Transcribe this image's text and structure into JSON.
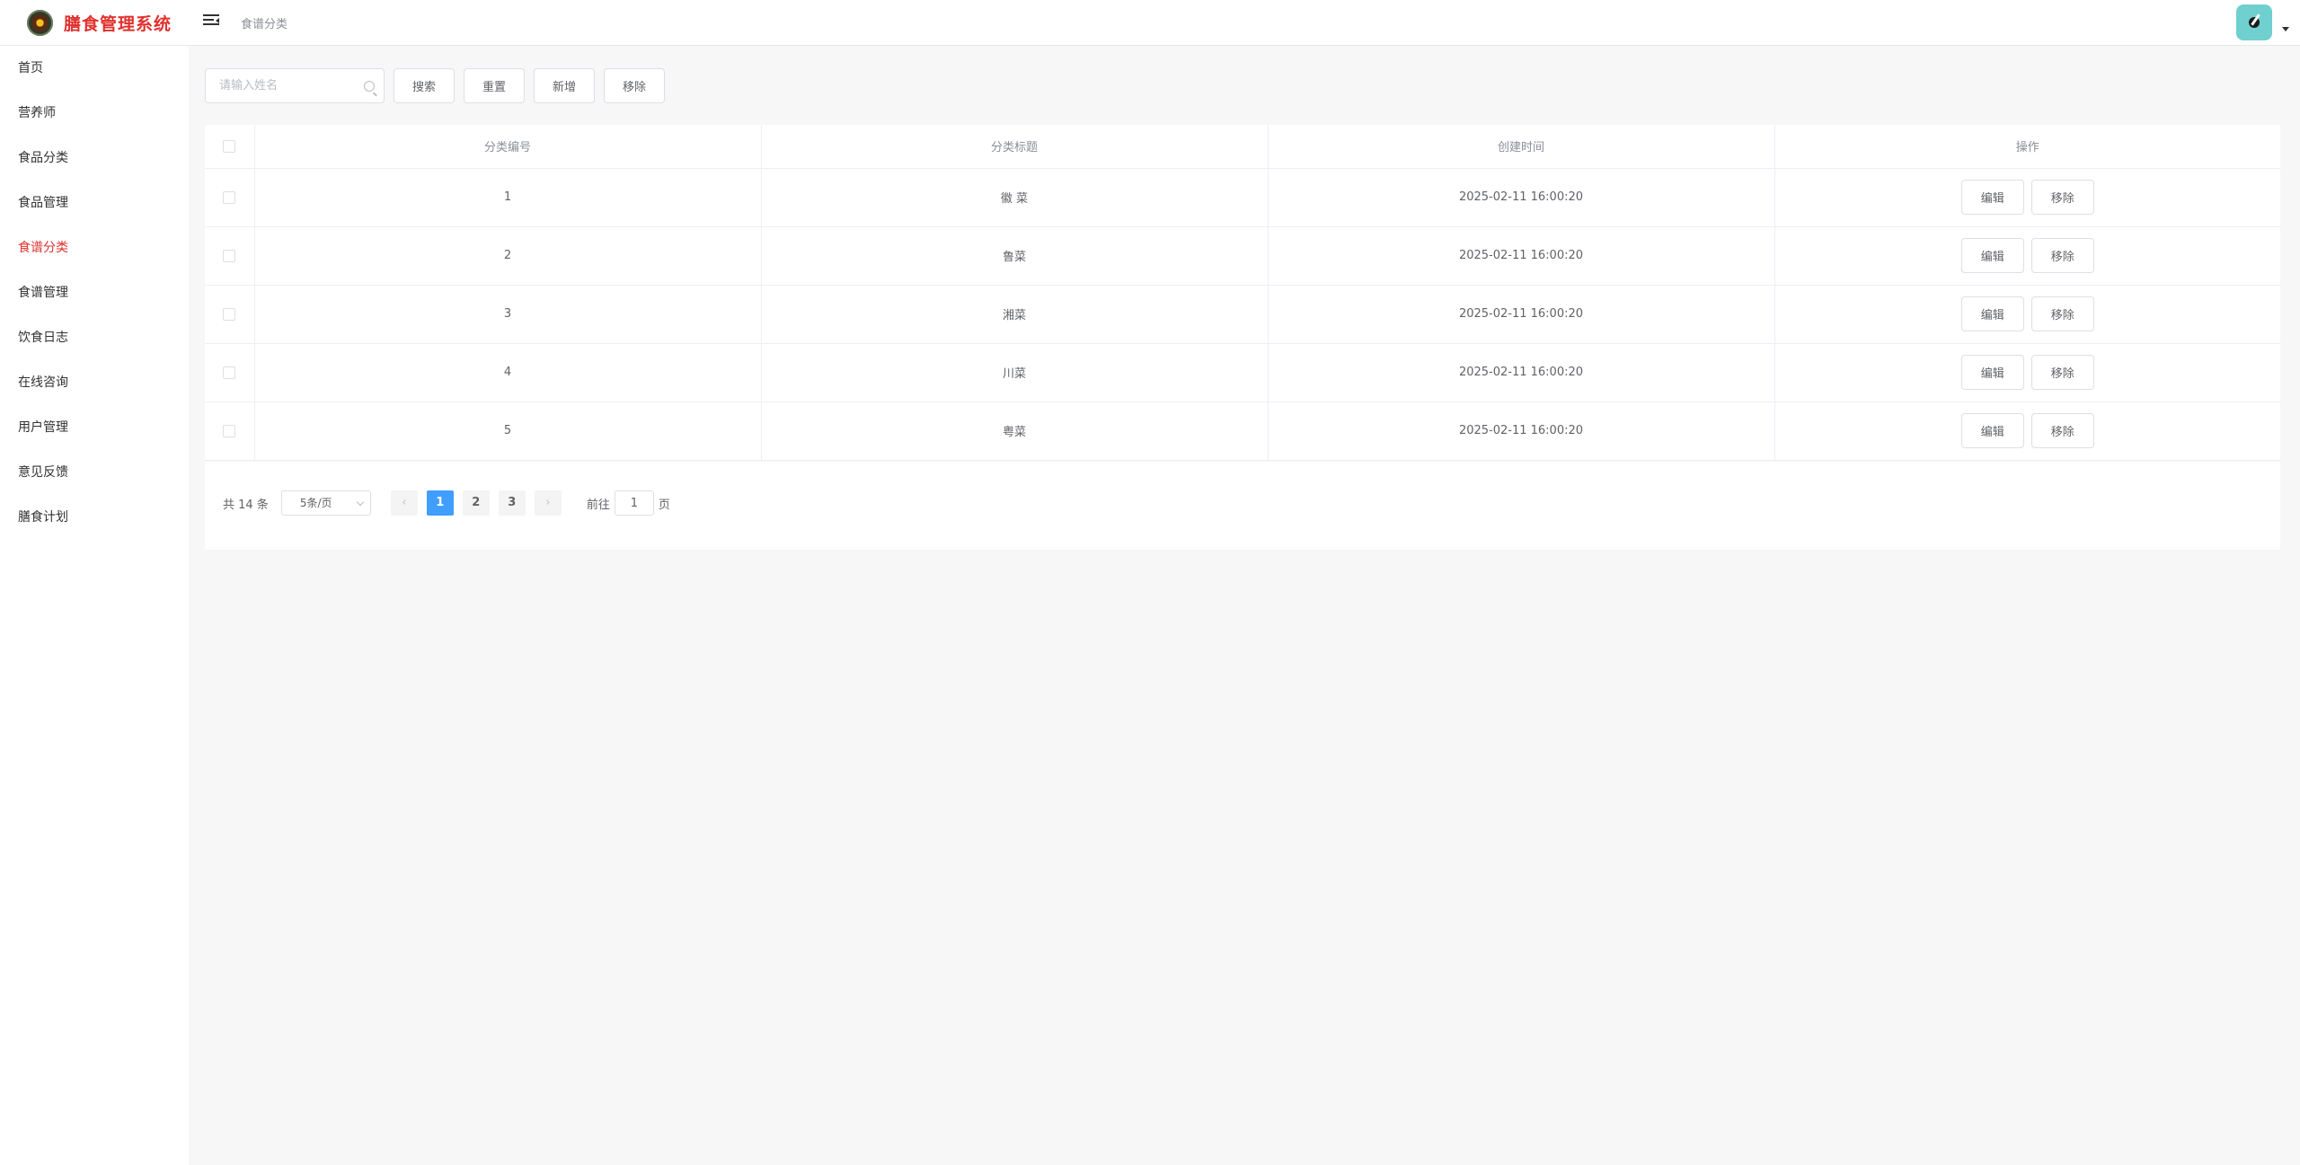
{
  "app": {
    "title": "膳食管理系统"
  },
  "header": {
    "breadcrumb": "食谱分类"
  },
  "sidebar": {
    "items": [
      {
        "label": "首页",
        "active": false
      },
      {
        "label": "营养师",
        "active": false
      },
      {
        "label": "食品分类",
        "active": false
      },
      {
        "label": "食品管理",
        "active": false
      },
      {
        "label": "食谱分类",
        "active": true
      },
      {
        "label": "食谱管理",
        "active": false
      },
      {
        "label": "饮食日志",
        "active": false
      },
      {
        "label": "在线咨询",
        "active": false
      },
      {
        "label": "用户管理",
        "active": false
      },
      {
        "label": "意见反馈",
        "active": false
      },
      {
        "label": "膳食计划",
        "active": false
      }
    ]
  },
  "toolbar": {
    "search_placeholder": "请输入姓名",
    "search_label": "搜索",
    "reset_label": "重置",
    "add_label": "新增",
    "remove_label": "移除"
  },
  "table": {
    "columns": [
      "分类编号",
      "分类标题",
      "创建时间",
      "操作"
    ],
    "rows": [
      {
        "id": "1",
        "title": "徽 菜",
        "created": "2025-02-11 16:00:20"
      },
      {
        "id": "2",
        "title": "鲁菜",
        "created": "2025-02-11 16:00:20"
      },
      {
        "id": "3",
        "title": "湘菜",
        "created": "2025-02-11 16:00:20"
      },
      {
        "id": "4",
        "title": "川菜",
        "created": "2025-02-11 16:00:20"
      },
      {
        "id": "5",
        "title": "粤菜",
        "created": "2025-02-11 16:00:20"
      }
    ],
    "edit_label": "编辑",
    "remove_label": "移除"
  },
  "pagination": {
    "total_text": "共 14 条",
    "page_size": "5条/页",
    "pages": [
      "1",
      "2",
      "3"
    ],
    "current": "1",
    "goto_prefix": "前往",
    "goto_value": "1",
    "goto_suffix": "页"
  },
  "colors": {
    "brand": "#e0302d",
    "active_page": "#409eff",
    "avatar_bg": "#6fd0cf"
  }
}
